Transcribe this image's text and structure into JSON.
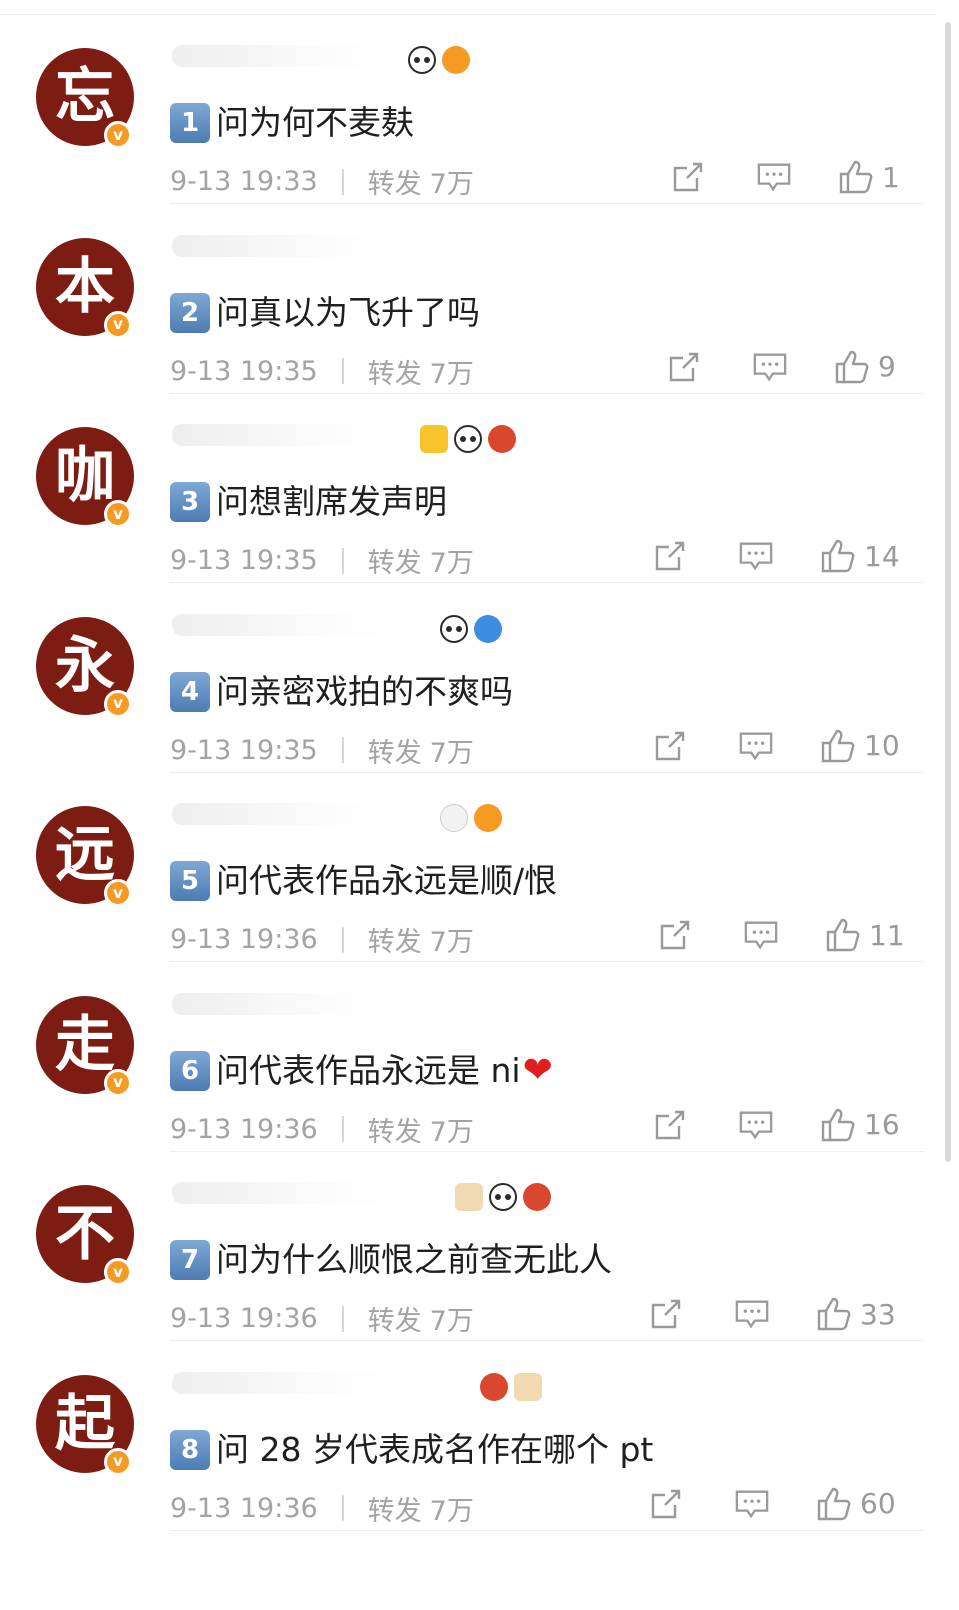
{
  "colors": {
    "avatar_bg": "#7c1c12",
    "verified_badge": "#f59a23",
    "rank_badge": "#4d7cb2",
    "meta_text": "#a3a3a3",
    "heart": "#e02020"
  },
  "labels": {
    "repost": "转发",
    "repost_count": "7万"
  },
  "icons": [
    "share-icon",
    "comment-icon",
    "like-icon",
    "verified-icon",
    "heart-icon"
  ],
  "comments": [
    {
      "avatar_char": "忘",
      "rank": "1",
      "text": "问为何不麦麸",
      "time": "9-13 19:33",
      "likes": "1",
      "emoji": [
        "panda",
        "orange"
      ]
    },
    {
      "avatar_char": "本",
      "rank": "2",
      "text": "问真以为飞升了吗",
      "time": "9-13 19:35",
      "likes": "9",
      "emoji": []
    },
    {
      "avatar_char": "咖",
      "rank": "3",
      "text": "问想割席发声明",
      "time": "9-13 19:35",
      "likes": "14",
      "emoji": [
        "gold",
        "panda",
        "red"
      ]
    },
    {
      "avatar_char": "永",
      "rank": "4",
      "text": "问亲密戏拍的不爽吗",
      "time": "9-13 19:35",
      "likes": "10",
      "emoji": [
        "panda",
        "blue"
      ]
    },
    {
      "avatar_char": "远",
      "rank": "5",
      "text": "问代表作品永远是顺/恨",
      "time": "9-13 19:36",
      "likes": "11",
      "emoji": [
        "face",
        "orange"
      ]
    },
    {
      "avatar_char": "走",
      "rank": "6",
      "text": "问代表作品永远是 ni",
      "time": "9-13 19:36",
      "likes": "16",
      "emoji": [],
      "heart": "❤"
    },
    {
      "avatar_char": "不",
      "rank": "7",
      "text": "问为什么顺恨之前查无此人",
      "time": "9-13 19:36",
      "likes": "33",
      "emoji": [
        "beige",
        "panda",
        "red"
      ]
    },
    {
      "avatar_char": "起",
      "rank": "8",
      "text": "问 28 岁代表成名作在哪个 pt",
      "time": "9-13 19:36",
      "likes": "60",
      "emoji": [
        "red",
        "beige"
      ]
    }
  ]
}
